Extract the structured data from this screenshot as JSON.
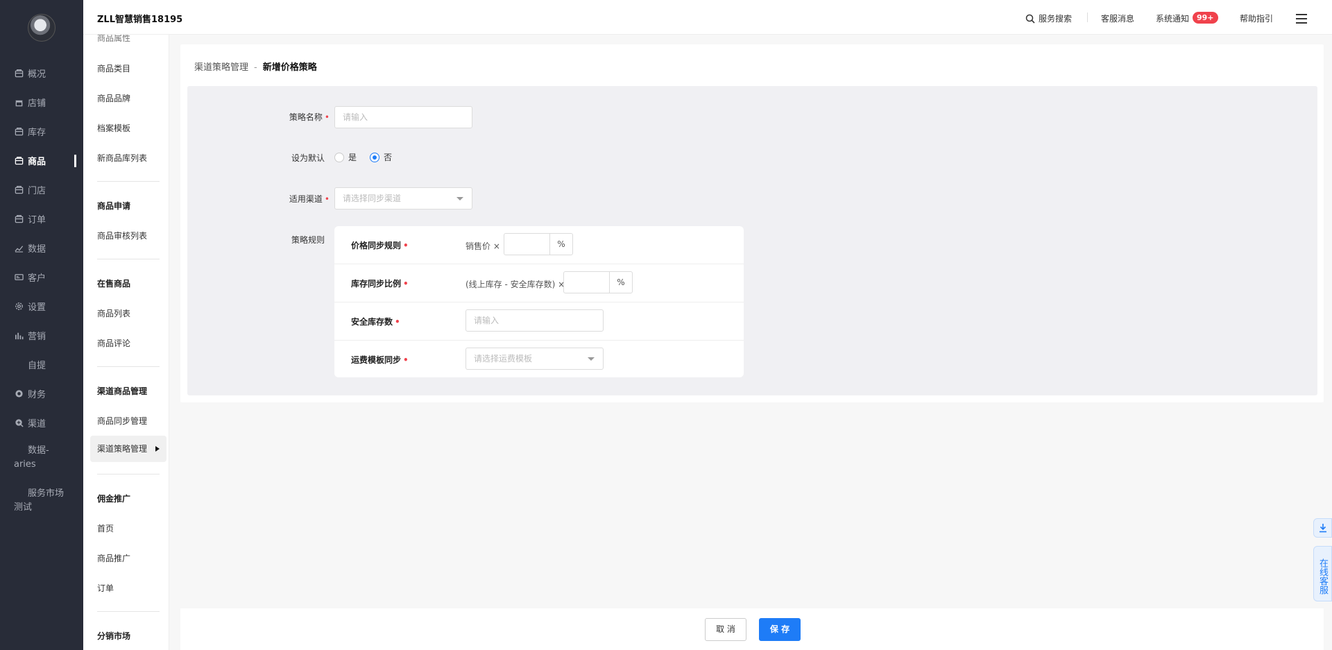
{
  "header": {
    "shop_name": "ZLL智慧销售18195",
    "search_label": "服务搜索",
    "cs_message": "客服消息",
    "notify_label": "系统通知",
    "notify_badge": "99+",
    "help_label": "帮助指引"
  },
  "leftnav": {
    "items": [
      {
        "label": "概况",
        "icon": "box-icon"
      },
      {
        "label": "店铺",
        "icon": "shop-icon"
      },
      {
        "label": "库存",
        "icon": "box-icon"
      },
      {
        "label": "商品",
        "icon": "box-icon"
      },
      {
        "label": "门店",
        "icon": "box-icon"
      },
      {
        "label": "订单",
        "icon": "box-icon"
      },
      {
        "label": "数据",
        "icon": "chart-icon"
      },
      {
        "label": "客户",
        "icon": "card-icon"
      },
      {
        "label": "设置",
        "icon": "gear-icon"
      },
      {
        "label": "营销",
        "icon": "bars-icon"
      },
      {
        "label": "自提",
        "icon": ""
      },
      {
        "label": "财务",
        "icon": "coin-icon"
      },
      {
        "label": "渠道",
        "icon": "channel-icon"
      },
      {
        "label": "数据-aries",
        "icon": ""
      },
      {
        "label": "服务市场测试",
        "icon": ""
      }
    ],
    "active": "商品"
  },
  "subnav": {
    "top_cut": "商品属性",
    "g1_items": [
      "商品类目",
      "商品品牌",
      "档案模板",
      "新商品库列表"
    ],
    "g2_title": "商品申请",
    "g2_items": [
      "商品审核列表"
    ],
    "g3_title": "在售商品",
    "g3_items": [
      "商品列表",
      "商品评论"
    ],
    "g4_title": "渠道商品管理",
    "g4_items": [
      "商品同步管理",
      "渠道策略管理"
    ],
    "g5_title": "佣金推广",
    "g5_items": [
      "首页",
      "商品推广",
      "订单"
    ],
    "g6_title": "分销市场"
  },
  "breadcrumb": {
    "parent": "渠道策略管理",
    "sep": "-",
    "current": "新增价格策略"
  },
  "form": {
    "name_label": "策略名称",
    "name_placeholder": "请输入",
    "default_label": "设为默认",
    "default_yes": "是",
    "default_no": "否",
    "default_selected": "否",
    "channel_label": "适用渠道",
    "channel_placeholder": "请选择同步渠道",
    "rules_label": "策略规则",
    "rules": {
      "price_label": "价格同步规则",
      "price_prefix": "销售价 ×",
      "price_unit": "%",
      "stock_label": "库存同步比例",
      "stock_prefix": "(线上库存 - 安全库存数) ×",
      "stock_unit": "%",
      "safe_label": "安全库存数",
      "safe_placeholder": "请输入",
      "freight_label": "运费模板同步",
      "freight_placeholder": "请选择运费模板"
    }
  },
  "footer": {
    "cancel_label": "取 消",
    "save_label": "保 存"
  },
  "floating": {
    "cs_label": "在线客服"
  },
  "colors": {
    "nav_bg": "#282c38",
    "accent": "#1e7cf7",
    "required": "#f0424c",
    "badge": "#f0424c"
  }
}
